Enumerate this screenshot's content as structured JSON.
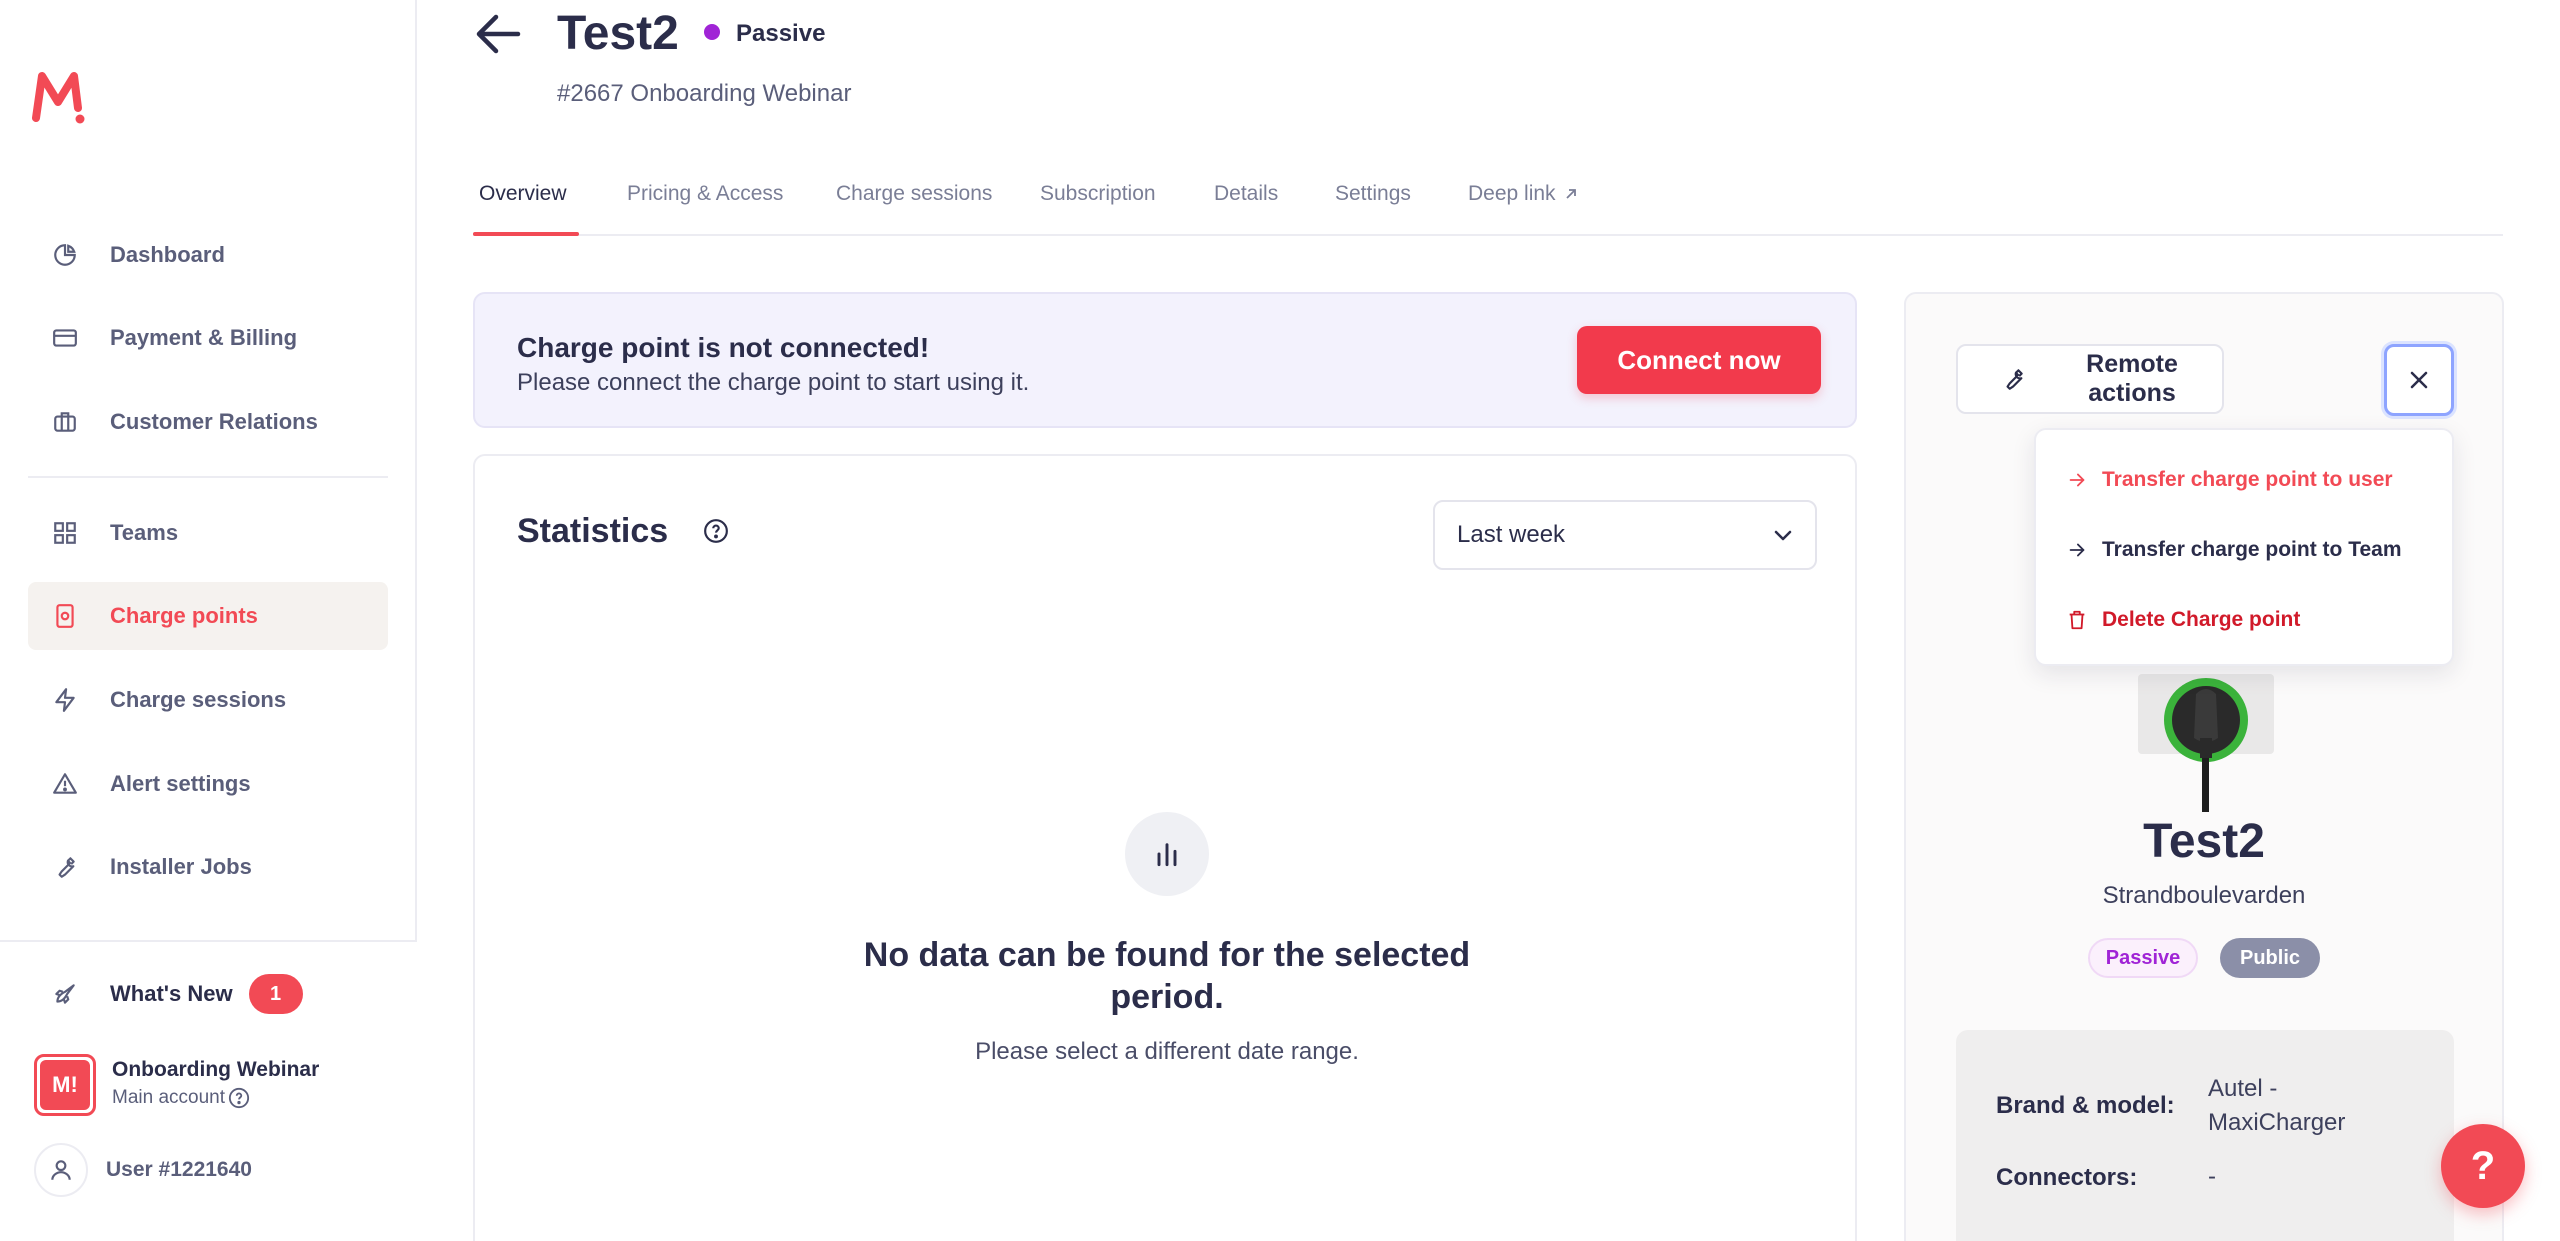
{
  "sidebar": {
    "logo_text": "M!",
    "items": [
      {
        "label": "Dashboard",
        "icon": "pie-chart-icon"
      },
      {
        "label": "Payment & Billing",
        "icon": "credit-card-icon"
      },
      {
        "label": "Customer Relations",
        "icon": "briefcase-icon"
      },
      {
        "label": "Teams",
        "icon": "grid-icon"
      },
      {
        "label": "Charge points",
        "icon": "charger-icon"
      },
      {
        "label": "Charge sessions",
        "icon": "lightning-icon"
      },
      {
        "label": "Alert settings",
        "icon": "alert-triangle-icon"
      },
      {
        "label": "Installer Jobs",
        "icon": "wrench-icon"
      }
    ],
    "whats_new": {
      "label": "What's New",
      "count": "1"
    },
    "account": {
      "avatar": "M!",
      "name": "Onboarding Webinar",
      "role": "Main account"
    },
    "user": {
      "label": "User #1221640"
    },
    "active_color": "#f24a55"
  },
  "header": {
    "title": "Test2",
    "status": "Passive",
    "status_color": "#a024d6",
    "subtitle": "#2667 Onboarding Webinar"
  },
  "tabs": [
    "Overview",
    "Pricing & Access",
    "Charge sessions",
    "Subscription",
    "Details",
    "Settings",
    "Deep link"
  ],
  "alert": {
    "title": "Charge point is not connected!",
    "subtitle": "Please connect the charge point to start using it.",
    "button": "Connect now"
  },
  "statistics": {
    "title": "Statistics",
    "period": "Last week",
    "empty_title": "No data can be found for the selected period.",
    "empty_sub": "Please select a different date range."
  },
  "right_panel": {
    "remote_actions": "Remote actions",
    "menu": [
      {
        "label": "Transfer charge point to user",
        "color": "#f24a55"
      },
      {
        "label": "Transfer charge point to Team",
        "color": "#2b2d4a"
      },
      {
        "label": "Delete Charge point",
        "color": "#d11a2a"
      }
    ],
    "name": "Test2",
    "location": "Strandboulevarden",
    "badges": [
      "Passive",
      "Public"
    ],
    "info": {
      "brand_label": "Brand & model:",
      "brand_value_1": "Autel -",
      "brand_value_2": "MaxiCharger",
      "connectors_label": "Connectors:",
      "connectors_value": "-"
    }
  },
  "help_button": "?"
}
